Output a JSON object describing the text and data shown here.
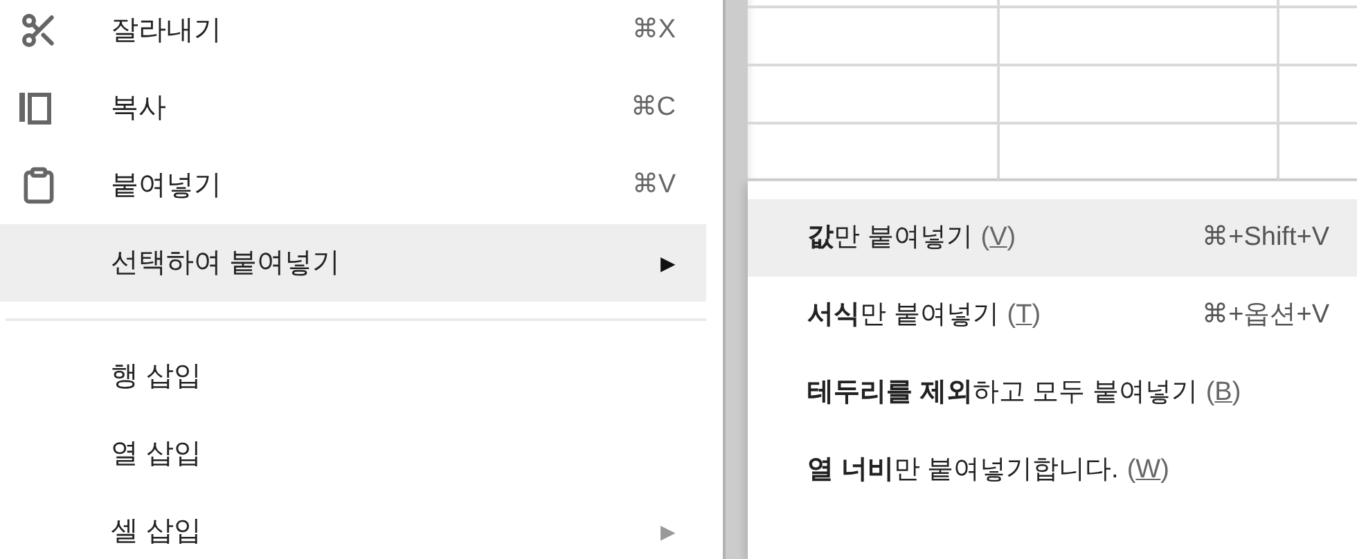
{
  "context_menu": {
    "groups": [
      {
        "items": [
          {
            "label": "잘라내기",
            "shortcut": "⌘X",
            "selected": false
          },
          {
            "label": "복사",
            "shortcut": "⌘C",
            "selected": false
          },
          {
            "label": "붙여넣기",
            "shortcut": "⌘V",
            "selected": false
          },
          {
            "label": "선택하여 붙여넣기",
            "arrow": "▶",
            "selected": true
          }
        ]
      },
      {
        "items": [
          {
            "label": "행 삽입",
            "selected": false
          },
          {
            "label": "열 삽입",
            "selected": false
          },
          {
            "label": "셀 삽입",
            "arrow": "▶",
            "selected": false
          }
        ]
      }
    ]
  },
  "submenu": {
    "items": [
      {
        "label": "**값**만 붙여넣기",
        "access_key": "(V)",
        "shortcut": "⌘+Shift+V",
        "selected": true
      },
      {
        "label": "**서식**만 붙여넣기",
        "access_key": "(T)",
        "shortcut": "⌘+옵션+V",
        "selected": false
      },
      {
        "label": "**테두리를 제외**하고 모두 붙여넣기",
        "access_key": "(B)",
        "selected": false
      },
      {
        "label": "**열 너비**만 붙여넣기합니다.",
        "access_key": "(W)",
        "selected": false
      }
    ]
  }
}
